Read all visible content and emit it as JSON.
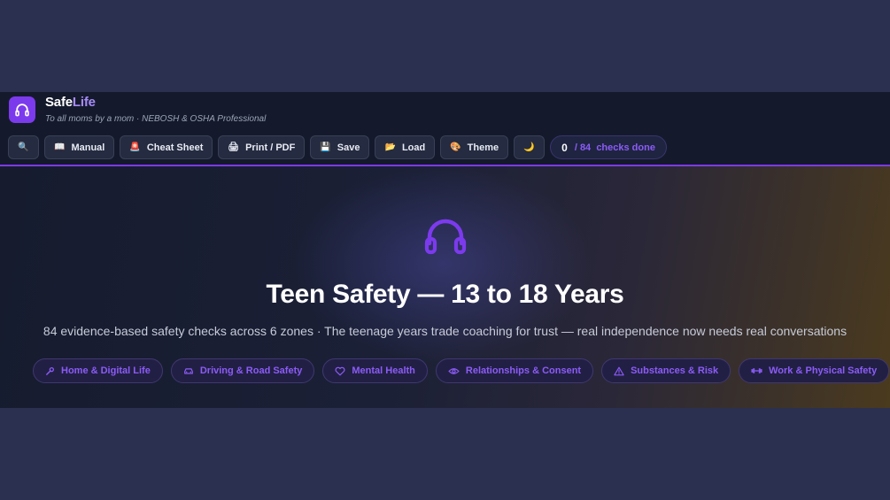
{
  "brand": {
    "name_main": "Safe",
    "name_accent": "Life",
    "tagline": "To all moms by a mom · NEBOSH & OSHA Professional"
  },
  "toolbar": {
    "search_icon": "🔍",
    "manual": {
      "icon": "📖",
      "label": "Manual"
    },
    "cheat": {
      "icon": "🚨",
      "label": "Cheat Sheet"
    },
    "print": {
      "icon": "🖨",
      "label": "Print / PDF"
    },
    "save": {
      "icon": "💾",
      "label": "Save"
    },
    "load": {
      "icon": "📂",
      "label": "Load"
    },
    "theme": {
      "icon": "🎨",
      "label": "Theme"
    },
    "moon_icon": "🌙"
  },
  "progress": {
    "count": "0",
    "total": "/ 84",
    "suffix": "checks done"
  },
  "hero": {
    "title": "Teen Safety — 13 to 18 Years",
    "subtitle": "84 evidence-based safety checks across 6 zones · The teenage years trade coaching for trust — real independence now needs real conversations"
  },
  "zones": [
    {
      "label": "Home & Digital Life",
      "icon": "wrench-icon"
    },
    {
      "label": "Driving & Road Safety",
      "icon": "car-icon"
    },
    {
      "label": "Mental Health",
      "icon": "heart-icon"
    },
    {
      "label": "Relationships & Consent",
      "icon": "eye-icon"
    },
    {
      "label": "Substances & Risk",
      "icon": "warning-icon"
    },
    {
      "label": "Work & Physical Safety",
      "icon": "dumbbell-icon"
    }
  ],
  "colors": {
    "accent": "#7c3aed",
    "accent_text": "#a78bfa",
    "background": "#2b3050"
  }
}
